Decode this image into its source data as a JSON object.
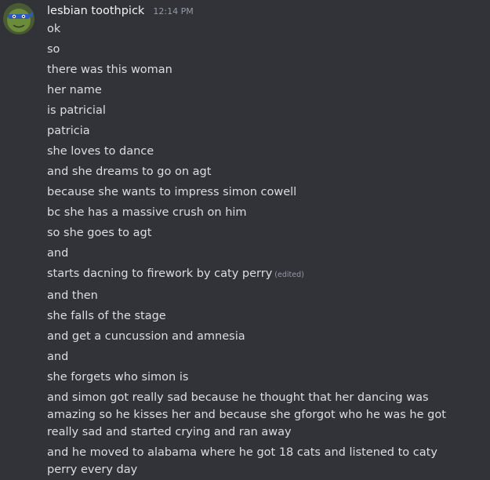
{
  "author": {
    "username": "lesbian toothpick",
    "timestamp": "12:14 PM",
    "avatar_icon": "ninja-turtle-avatar"
  },
  "colors": {
    "background": "#313338",
    "username": "#f2f3f5",
    "message_text": "#dbdee1",
    "muted": "#949ba4"
  },
  "messages": [
    {
      "text": "ok"
    },
    {
      "text": "so"
    },
    {
      "text": "there was this woman"
    },
    {
      "text": "her name"
    },
    {
      "text": "is patricial"
    },
    {
      "text": "patricia"
    },
    {
      "text": "she loves to dance"
    },
    {
      "text": "and she dreams to go on agt"
    },
    {
      "text": "because she wants to impress simon cowell"
    },
    {
      "text": "bc she has a massive crush on him"
    },
    {
      "text": "so she goes to agt"
    },
    {
      "text": "and"
    },
    {
      "text": "starts dacning to firework by caty perry",
      "edited": "(edited)"
    },
    {
      "text": "and then"
    },
    {
      "text": "she falls of the stage"
    },
    {
      "text": "and get a cuncussion and amnesia"
    },
    {
      "text": "and"
    },
    {
      "text": "she forgets who simon is"
    },
    {
      "text": "and simon got really sad because he thought that her dancing was amazing so he kisses her and because she gforgot who he was he got really sad and started crying and ran away"
    },
    {
      "text": "and he moved to alabama where he got 18 cats and listened to caty perry every day"
    }
  ]
}
